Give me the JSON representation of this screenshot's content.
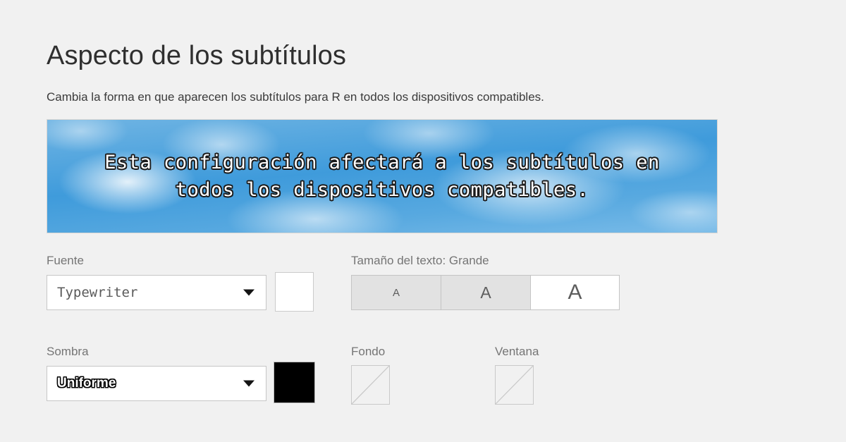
{
  "page": {
    "title": "Aspecto de los subtítulos",
    "description": "Cambia la forma en que aparecen los subtítulos para R en todos los dispositivos compatibles.",
    "background_color": "#f1f1f1"
  },
  "preview": {
    "text": "Esta configuración afectará a los subtítulos en todos los dispositivos compatibles.",
    "text_color": "#ffffff",
    "shadow_color": "#000000",
    "background_color": "#4ea3dd"
  },
  "controls": {
    "font": {
      "label": "Fuente",
      "value": "Typewriter",
      "arrow_icon": "chevron-down-icon",
      "color_swatch": {
        "name": "font-color-swatch",
        "color": "#ffffff"
      }
    },
    "text_size": {
      "label": "Tamaño del texto: Grande",
      "selected": "Grande",
      "options": [
        {
          "glyph": "A",
          "size_name": "Pequeño",
          "selected": false
        },
        {
          "glyph": "A",
          "size_name": "Mediano",
          "selected": false
        },
        {
          "glyph": "A",
          "size_name": "Grande",
          "selected": true
        }
      ]
    },
    "shadow": {
      "label": "Sombra",
      "value": "Uniforme",
      "arrow_icon": "chevron-down-icon",
      "color_swatch": {
        "name": "shadow-color-swatch",
        "color": "#000000"
      }
    },
    "background": {
      "label": "Fondo",
      "color_swatch": {
        "name": "background-color-swatch",
        "color": "transparent"
      }
    },
    "window": {
      "label": "Ventana",
      "color_swatch": {
        "name": "window-color-swatch",
        "color": "transparent"
      }
    }
  }
}
